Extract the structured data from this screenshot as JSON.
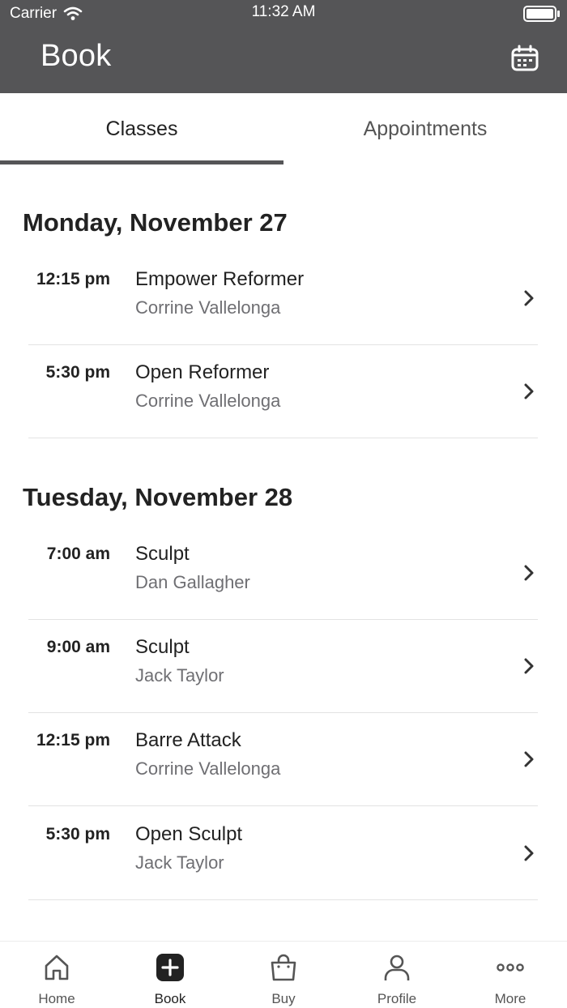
{
  "status_bar": {
    "carrier": "Carrier",
    "time": "11:32 AM"
  },
  "header": {
    "title": "Book",
    "calendar_icon": "calendar-icon"
  },
  "tabs": [
    {
      "label": "Classes",
      "selected": true
    },
    {
      "label": "Appointments",
      "selected": false
    }
  ],
  "days": [
    {
      "heading": "Monday, November 27",
      "classes": [
        {
          "time": "12:15 pm",
          "name": "Empower Reformer",
          "instructor": "Corrine Vallelonga"
        },
        {
          "time": "5:30 pm",
          "name": "Open Reformer",
          "instructor": "Corrine Vallelonga"
        }
      ]
    },
    {
      "heading": "Tuesday, November 28",
      "classes": [
        {
          "time": "7:00 am",
          "name": "Sculpt",
          "instructor": "Dan Gallagher"
        },
        {
          "time": "9:00 am",
          "name": "Sculpt",
          "instructor": "Jack Taylor"
        },
        {
          "time": "12:15 pm",
          "name": "Barre Attack",
          "instructor": "Corrine Vallelonga"
        },
        {
          "time": "5:30 pm",
          "name": "Open Sculpt",
          "instructor": "Jack Taylor"
        }
      ]
    }
  ],
  "tab_bar": [
    {
      "label": "Home",
      "icon": "home-icon",
      "active": false
    },
    {
      "label": "Book",
      "icon": "plus-square-icon",
      "active": true
    },
    {
      "label": "Buy",
      "icon": "shopping-bag-icon",
      "active": false
    },
    {
      "label": "Profile",
      "icon": "person-icon",
      "active": false
    },
    {
      "label": "More",
      "icon": "more-dots-icon",
      "active": false
    }
  ],
  "colors": {
    "header_bg": "#555557",
    "tab_indicator": "#555557",
    "active_tab_text": "#222222",
    "secondary_text": "#6f6f73"
  }
}
